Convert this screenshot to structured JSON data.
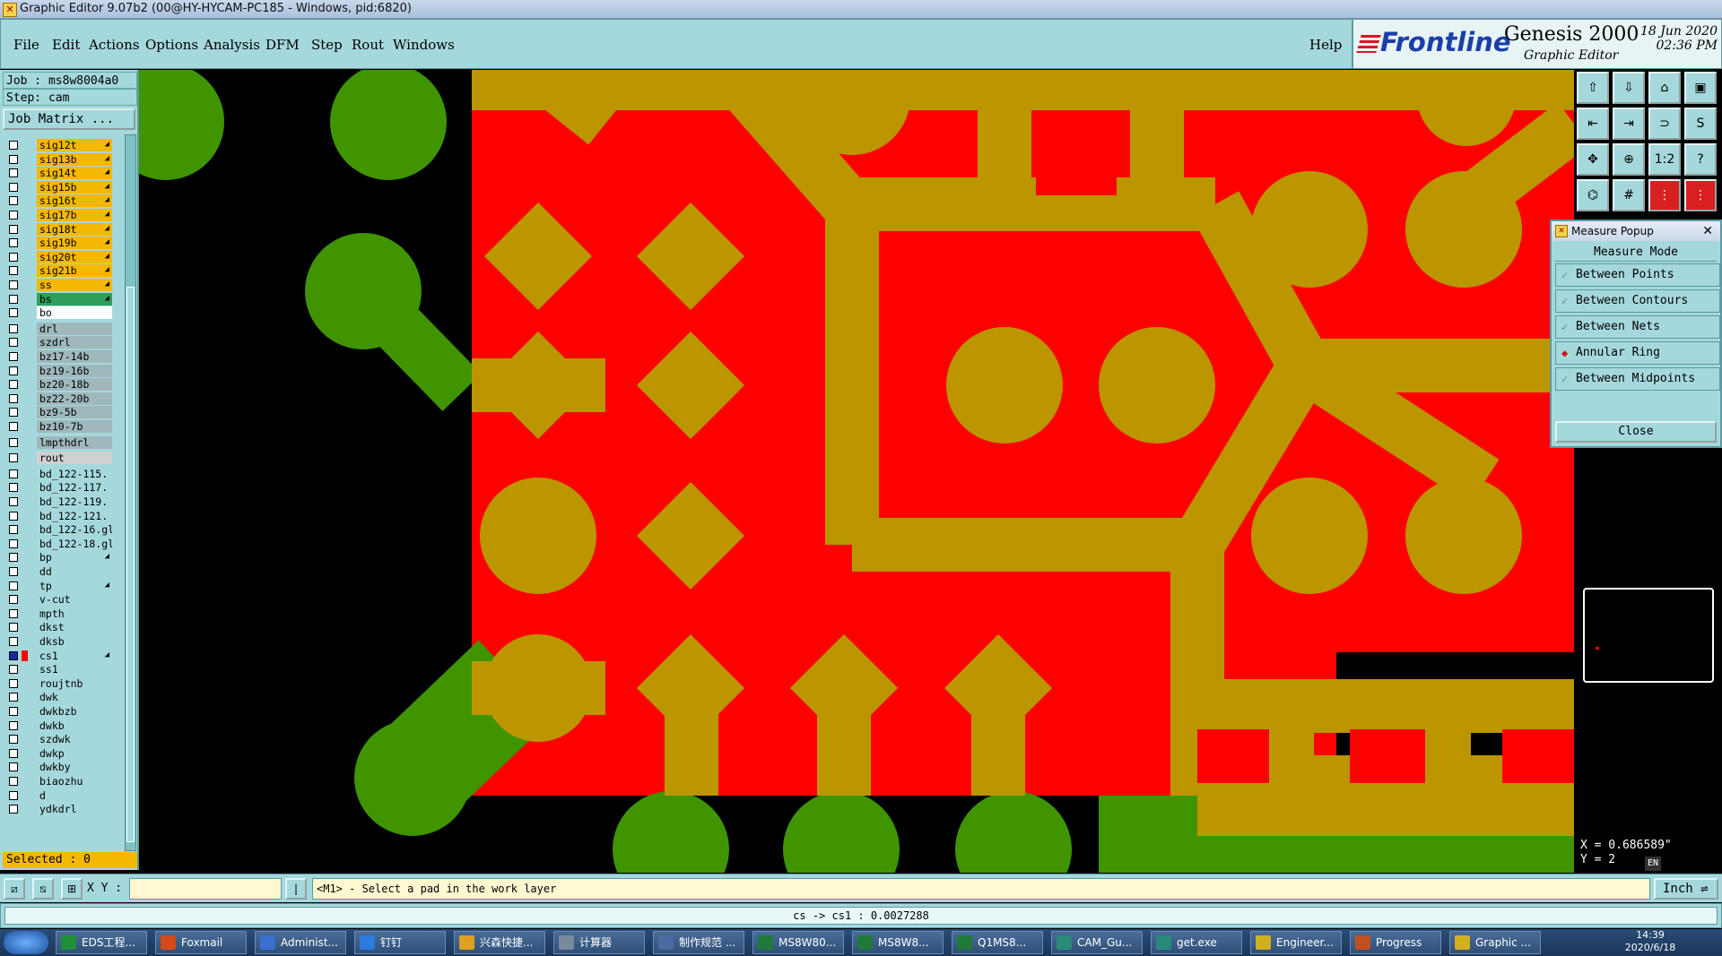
{
  "window": {
    "title": "Graphic Editor 9.07b2 (00@HY-HYCAM-PC185 - Windows, pid:6820)"
  },
  "menu": {
    "items": [
      "File",
      "Edit",
      "Actions",
      "Options",
      "Analysis",
      "DFM",
      "Step",
      "Rout",
      "Windows"
    ],
    "help": "Help"
  },
  "brand": {
    "logo": "Frontline",
    "product": "Genesis 2000",
    "subtitle": "Graphic Editor",
    "date": "18 Jun 2020",
    "time": "02:36 PM"
  },
  "job": {
    "job_label": "Job : ms8w8004a0",
    "step_label": "Step: cam",
    "matrix_button": "Job Matrix ..."
  },
  "layers": [
    {
      "name": "sig12t",
      "color": "#f5b800",
      "arrow": true
    },
    {
      "name": "sig13b",
      "color": "#f5b800",
      "arrow": true
    },
    {
      "name": "sig14t",
      "color": "#f5b800",
      "arrow": true
    },
    {
      "name": "sig15b",
      "color": "#f5b800",
      "arrow": true
    },
    {
      "name": "sig16t",
      "color": "#f5b800",
      "arrow": true
    },
    {
      "name": "sig17b",
      "color": "#f5b800",
      "arrow": true
    },
    {
      "name": "sig18t",
      "color": "#f5b800",
      "arrow": true
    },
    {
      "name": "sig19b",
      "color": "#f5b800",
      "arrow": true
    },
    {
      "name": "sig20t",
      "color": "#f5b800",
      "arrow": true
    },
    {
      "name": "sig21b",
      "color": "#f5b800",
      "arrow": true
    },
    {
      "name": "ss",
      "color": "#f5b800",
      "arrow": true
    },
    {
      "name": "bs",
      "color": "#2e9e5a",
      "arrow": true
    },
    {
      "name": "bo",
      "color": "#ffffff",
      "arrow": false
    },
    {
      "name": "drl",
      "color": "#9fb8bc",
      "arrow": false,
      "gap": true
    },
    {
      "name": "szdrl",
      "color": "#9fb8bc",
      "arrow": false
    },
    {
      "name": "bz17-14b",
      "color": "#9fb8bc",
      "arrow": false
    },
    {
      "name": "bz19-16b",
      "color": "#9fb8bc",
      "arrow": false
    },
    {
      "name": "bz20-18b",
      "color": "#9fb8bc",
      "arrow": false
    },
    {
      "name": "bz22-20b",
      "color": "#9fb8bc",
      "arrow": false
    },
    {
      "name": "bz9-5b",
      "color": "#9fb8bc",
      "arrow": false
    },
    {
      "name": "bz10-7b",
      "color": "#9fb8bc",
      "arrow": false
    },
    {
      "name": "lmpthdrl",
      "color": "#9fb8bc",
      "arrow": false,
      "gap": true
    },
    {
      "name": "rout",
      "color": "#d0d0d0",
      "arrow": false,
      "gap": true
    },
    {
      "name": "bd_122-115.",
      "color": "#a5d8dc",
      "arrow": false,
      "gap": true
    },
    {
      "name": "bd_122-117.",
      "color": "#a5d8dc",
      "arrow": false
    },
    {
      "name": "bd_122-119.",
      "color": "#a5d8dc",
      "arrow": false
    },
    {
      "name": "bd_122-121.",
      "color": "#a5d8dc",
      "arrow": false
    },
    {
      "name": "bd_122-16.gl",
      "color": "#a5d8dc",
      "arrow": false
    },
    {
      "name": "bd_122-18.gl",
      "color": "#a5d8dc",
      "arrow": false
    },
    {
      "name": "bp",
      "color": "#a5d8dc",
      "arrow": true
    },
    {
      "name": "dd",
      "color": "#a5d8dc",
      "arrow": false
    },
    {
      "name": "tp",
      "color": "#a5d8dc",
      "arrow": true
    },
    {
      "name": "v-cut",
      "color": "#a5d8dc",
      "arrow": false
    },
    {
      "name": "mpth",
      "color": "#a5d8dc",
      "arrow": false
    },
    {
      "name": "dkst",
      "color": "#a5d8dc",
      "arrow": false
    },
    {
      "name": "dksb",
      "color": "#a5d8dc",
      "arrow": false
    },
    {
      "name": "cs1",
      "color": "#a5d8dc",
      "arrow": true,
      "active": true
    },
    {
      "name": "ss1",
      "color": "#a5d8dc",
      "arrow": false
    },
    {
      "name": "roujtnb",
      "color": "#a5d8dc",
      "arrow": false
    },
    {
      "name": "dwk",
      "color": "#a5d8dc",
      "arrow": false
    },
    {
      "name": "dwkbzb",
      "color": "#a5d8dc",
      "arrow": false
    },
    {
      "name": "dwkb",
      "color": "#a5d8dc",
      "arrow": false
    },
    {
      "name": "szdwk",
      "color": "#a5d8dc",
      "arrow": false
    },
    {
      "name": "dwkp",
      "color": "#a5d8dc",
      "arrow": false
    },
    {
      "name": "dwkby",
      "color": "#a5d8dc",
      "arrow": false
    },
    {
      "name": "biaozhu",
      "color": "#a5d8dc",
      "arrow": false
    },
    {
      "name": "d",
      "color": "#a5d8dc",
      "arrow": false
    },
    {
      "name": "ydkdrl",
      "color": "#a5d8dc",
      "arrow": false
    }
  ],
  "selected": "Selected : 0",
  "colors": {
    "red_layer": "#ff0000",
    "gold_layer": "#bb9600",
    "green_layer": "#3f9400",
    "panel": "#a5d8dc",
    "orange": "#f5b800"
  },
  "measure_popup": {
    "title": "Measure Popup",
    "mode_label": "Measure Mode",
    "options": [
      "Between Points",
      "Between Contours",
      "Between Nets",
      "Annular Ring",
      "Between Midpoints"
    ],
    "selected": "Annular Ring",
    "close": "Close"
  },
  "coords": {
    "x": "X = 0.686589\"",
    "y": "Y = 2"
  },
  "ime": "EN",
  "bottom": {
    "xy_label": "X Y :",
    "xy_value": "",
    "prompt": "<M1> - Select a pad in the work layer",
    "unit": "Inch"
  },
  "status": "cs -> cs1 : 0.0027288",
  "taskbar": {
    "tasks": [
      "EDS工程...",
      "Foxmail",
      "Administ...",
      "钉钉",
      "兴森快捷...",
      "计算器",
      "制作规范 ...",
      "MS8W80...",
      "MS8W8...",
      "Q1MS8...",
      "CAM_Gu...",
      "get.exe",
      "Engineer...",
      "Progress",
      "Graphic ..."
    ],
    "clock_time": "14:39",
    "clock_date": "2020/6/18"
  }
}
